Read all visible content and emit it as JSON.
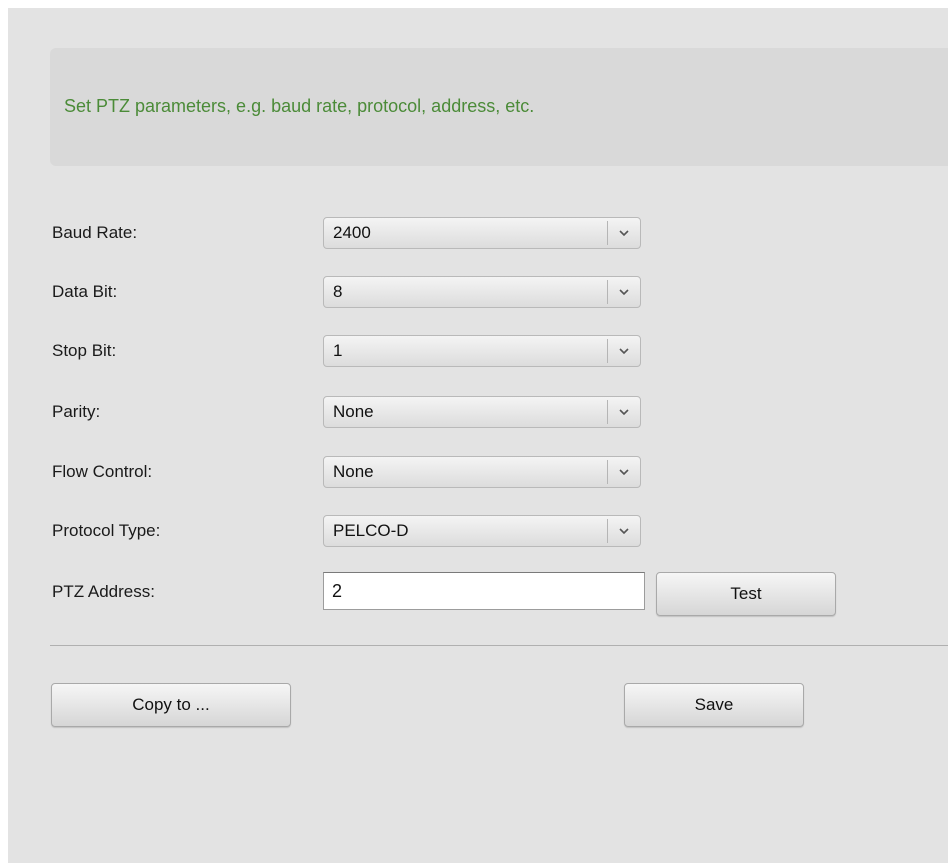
{
  "info": {
    "text": "Set PTZ parameters, e.g. baud rate, protocol, address, etc."
  },
  "fields": {
    "baud_rate": {
      "label": "Baud Rate:",
      "value": "2400"
    },
    "data_bit": {
      "label": "Data Bit:",
      "value": "8"
    },
    "stop_bit": {
      "label": "Stop Bit:",
      "value": "1"
    },
    "parity": {
      "label": "Parity:",
      "value": "None"
    },
    "flow_control": {
      "label": "Flow Control:",
      "value": "None"
    },
    "protocol_type": {
      "label": "Protocol Type:",
      "value": "PELCO-D"
    },
    "ptz_address": {
      "label": "PTZ Address:",
      "value": "2"
    }
  },
  "buttons": {
    "test": "Test",
    "copy_to": "Copy to ...",
    "save": "Save"
  },
  "icons": {
    "dropdown": "chevron-down-icon"
  }
}
